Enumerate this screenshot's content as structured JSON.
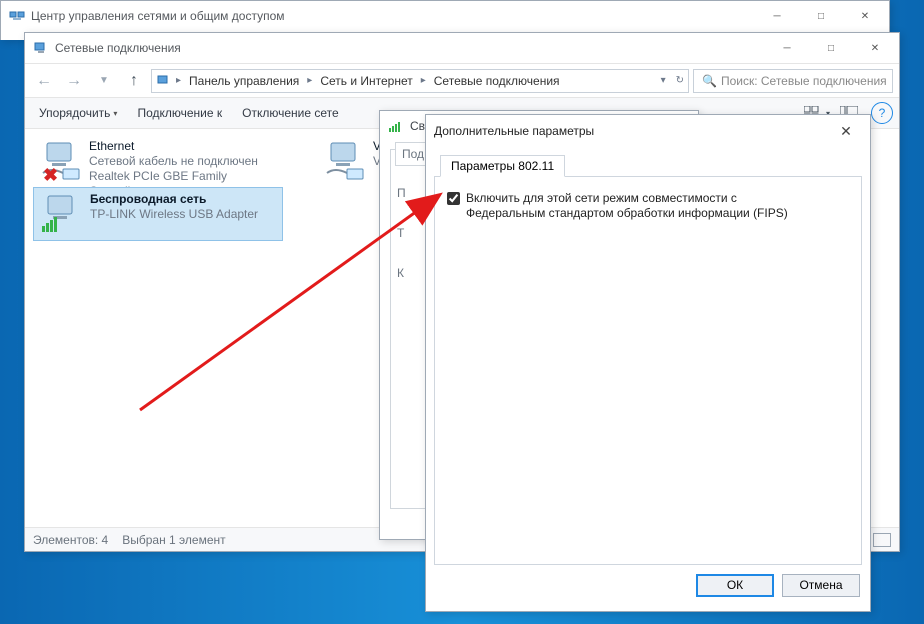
{
  "win1": {
    "title": "Центр управления сетями и общим доступом"
  },
  "win2": {
    "title": "Сетевые подключения",
    "breadcrumb": {
      "root": "Панель управления",
      "mid": "Сеть и Интернет",
      "leaf": "Сетевые подключения"
    },
    "search_placeholder": "Поиск: Сетевые подключения",
    "toolbar": {
      "organize": "Упорядочить",
      "connect": "Подключение к",
      "disconnect": "Отключение сете"
    }
  },
  "adapters": [
    {
      "name": "Ethernet",
      "status": "Сетевой кабель не подключен",
      "device": "Realtek PCIe GBE Family Controller",
      "error": true
    },
    {
      "name": "Беспроводная сеть",
      "status": "",
      "device": "TP-LINK Wireless USB Adapter",
      "wifi": true
    },
    {
      "name": "VMw",
      "status": "",
      "device": "VMw"
    }
  ],
  "status": {
    "count_label": "Элементов: 4",
    "selected_label": "Выбран 1 элемент"
  },
  "win3": {
    "title_prefix": "Сво",
    "tab_prefix": "Под",
    "rows": [
      "П",
      "Т",
      "К"
    ]
  },
  "win4": {
    "title": "Дополнительные параметры",
    "tab": "Параметры 802.11",
    "checkbox_label_line1": "Включить для этой сети режим совместимости с",
    "checkbox_label_line2": "Федеральным стандартом обработки информации (FIPS)",
    "checked": true,
    "ok": "ОК",
    "cancel": "Отмена"
  }
}
